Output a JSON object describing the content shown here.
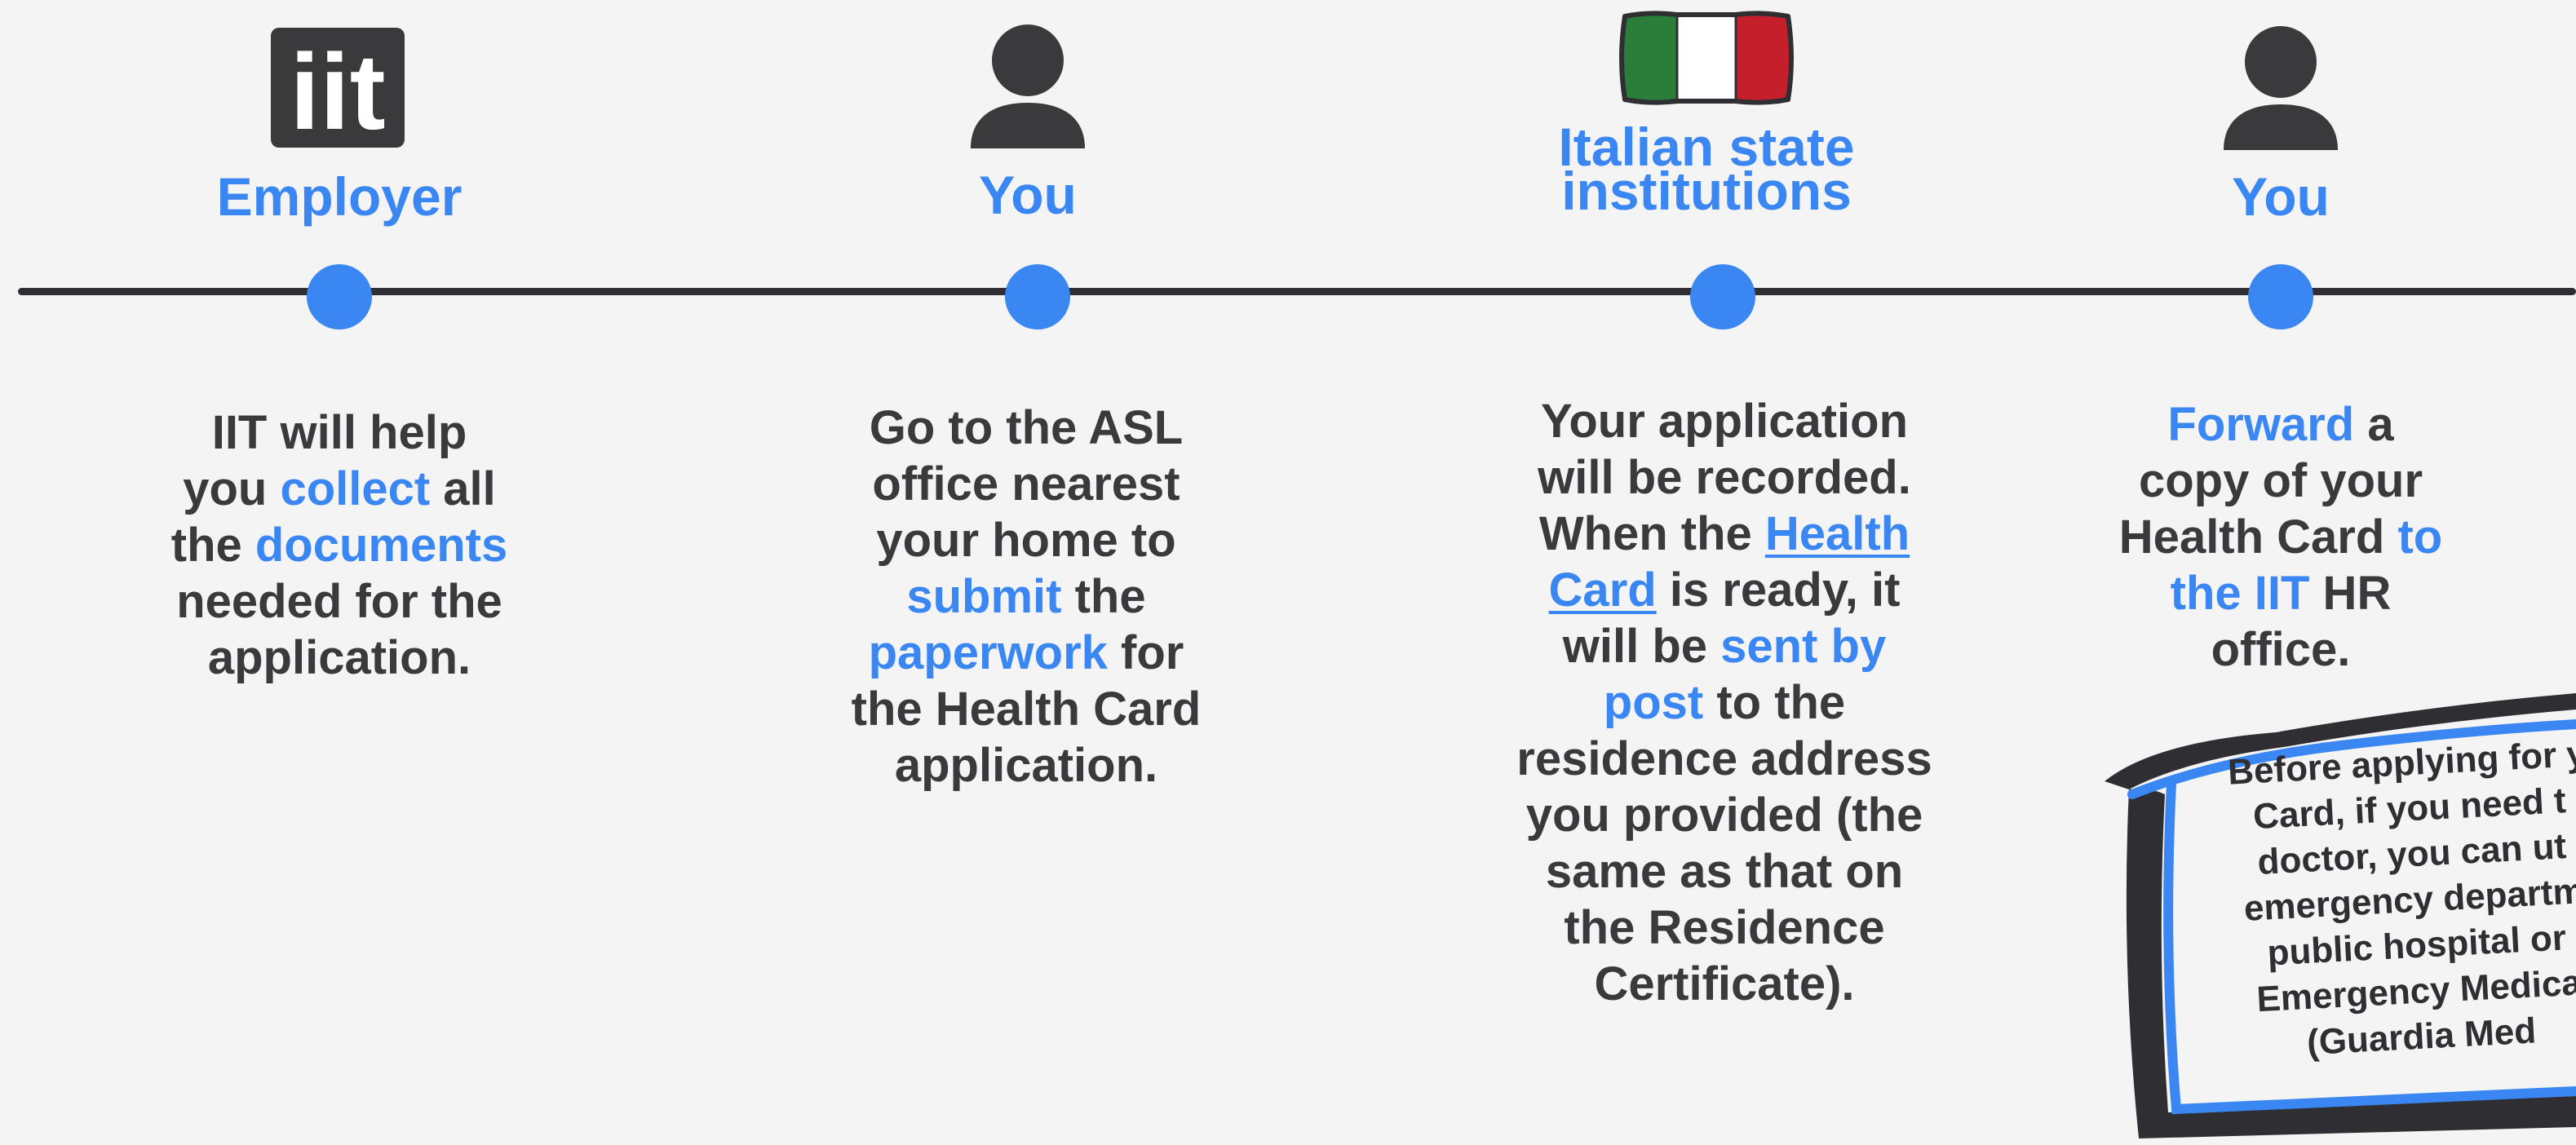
{
  "colors": {
    "accent": "#3a86f2",
    "text": "#3a3a3d",
    "line": "#2f2f33",
    "background": "#f4f4f4"
  },
  "steps": [
    {
      "icon": "iit-logo-icon",
      "logo_text": "iit",
      "role": "Employer",
      "desc": {
        "l1": "IIT will help",
        "l2a": "you ",
        "l2b": "collect",
        "l2c": " all",
        "l3a": "the ",
        "l3b": "documents",
        "l4": "needed for the",
        "l5": "application."
      }
    },
    {
      "icon": "person-icon",
      "role": "You",
      "desc": {
        "l1": "Go to the ASL",
        "l2": "office nearest",
        "l3": "your home to",
        "l4a": "submit",
        "l4b": " the",
        "l5a": "paperwork",
        "l5b": " for",
        "l6": "the Health Card",
        "l7": "application."
      }
    },
    {
      "icon": "italian-flag-icon",
      "role_l1": "Italian state",
      "role_l2": "institutions",
      "desc": {
        "l1": "Your application",
        "l2": "will be recorded.",
        "l3a": "When the ",
        "l3b": "Health",
        "l4a": "Card",
        "l4b": " is ready, it",
        "l5a": "will be ",
        "l5b": "sent by",
        "l6a": "post",
        "l6b": " to the",
        "l7": "residence address",
        "l8": "you provided (the",
        "l9": "same as that on",
        "l10": "the Residence",
        "l11": "Certificate)."
      }
    },
    {
      "icon": "person-icon",
      "role": "You",
      "desc": {
        "l1a": "Forward",
        "l1b": " a",
        "l2": "copy of your",
        "l3a": "Health Card ",
        "l3b": "to",
        "l4a": "the IIT",
        "l4b": " HR",
        "l5": "office."
      }
    }
  ],
  "note": {
    "lines": [
      "Before applying for y",
      "Card, if you need t",
      "doctor, you can ut",
      "emergency departm",
      "public hospital or",
      "Emergency Medica",
      "(Guardia Med"
    ]
  }
}
